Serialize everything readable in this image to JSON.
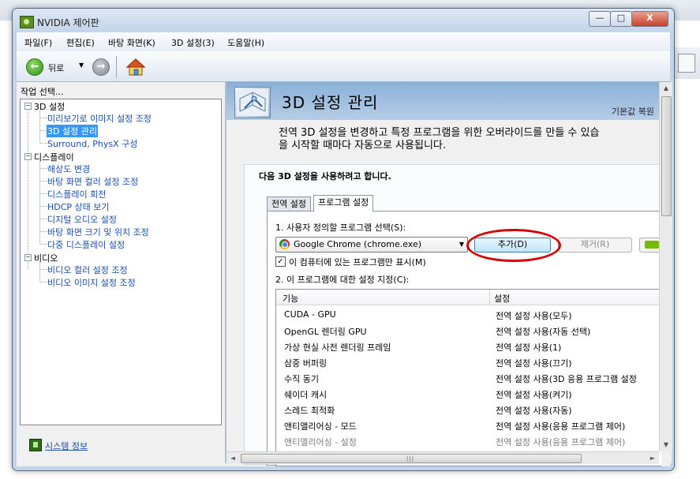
{
  "window": {
    "title": "NVIDIA 제어판",
    "controls": {
      "minimize": "—",
      "maximize": "□",
      "close": "X"
    }
  },
  "menu": [
    "파일(F)",
    "편집(E)",
    "바탕 화면(K)",
    "3D 설정(3)",
    "도움말(H)"
  ],
  "toolbar": {
    "back_label": "뒤로",
    "dropdown_arrow": "▼",
    "back_icon": "left-arrow-icon",
    "forward_icon": "right-arrow-icon",
    "home_icon": "home-icon"
  },
  "sidebar": {
    "header": "작업 선택...",
    "groups": [
      {
        "label": "3D 설정",
        "toggle": "−",
        "items": [
          "미리보기로 이미지 설정 조정",
          "3D 설정 관리",
          "Surround, PhysX 구성"
        ]
      },
      {
        "label": "디스플레이",
        "toggle": "−",
        "items": [
          "해상도 변경",
          "바탕 화면 컬러 설정 조정",
          "디스플레이 회전",
          "HDCP 상태 보기",
          "디지털 오디오 설정",
          "바탕 화면 크기 및 위치 조정",
          "다중 디스플레이 설정"
        ]
      },
      {
        "label": "비디오",
        "toggle": "−",
        "items": [
          "비디오 컬러 설정 조정",
          "비디오 이미지 설정 조정"
        ]
      }
    ],
    "selected_item": "3D 설정 관리",
    "system_info": "시스템 정보"
  },
  "main": {
    "title": "3D 설정 관리",
    "restore_defaults": "기본값 복원",
    "description_line1": "전역 3D 설정을 변경하고 특정 프로그램을 위한 오버라이드를 만들 수 있습",
    "description_line2": "을 시작할 때마다 자동으로 사용됩니다.",
    "panel_title": "다음 3D 설정을 사용하려고 합니다.",
    "tabs": [
      "전역 설정",
      "프로그램 설정"
    ],
    "active_tab": "프로그램 설정",
    "step1_label": "1. 사용자 정의할 프로그램 선택(S):",
    "program_combo": "Google Chrome (chrome.exe)",
    "add_button": "추가(D)",
    "remove_button": "제거(R)",
    "checkbox_label": "이 컴퓨터에 있는 프로그램만 표시(M)",
    "checkbox_checked": "✓",
    "step2_label": "2. 이 프로그램에 대한 설정 지정(C):",
    "columns": [
      "기능",
      "설정"
    ],
    "rows": [
      {
        "feature": "CUDA - GPU",
        "setting": "전역 설정 사용(모두)"
      },
      {
        "feature": "OpenGL 렌더링 GPU",
        "setting": "전역 설정 사용(자동 선택)"
      },
      {
        "feature": "가상 현실 사전 렌더링 프레임",
        "setting": "전역 설정 사용(1)"
      },
      {
        "feature": "삼중 버퍼링",
        "setting": "전역 설정 사용(끄기)"
      },
      {
        "feature": "수직 동기",
        "setting": "전역 설정 사용(3D 응용 프로그램 설정"
      },
      {
        "feature": "쉐이더 캐시",
        "setting": "전역 설정 사용(켜기)"
      },
      {
        "feature": "스레드 최적화",
        "setting": "전역 설정 사용(자동)"
      },
      {
        "feature": "앤티앨리어싱 - 모드",
        "setting": "전역 설정 사용(응용 프로그램 제어)"
      },
      {
        "feature": "앤티앨리어싱 - 설정",
        "setting": "전역 설정 사용(응용 프로그램 제어)"
      }
    ]
  },
  "colors": {
    "accent_red": "#d40000",
    "banner": "#8ab0d8",
    "link": "#1a4fb0"
  }
}
